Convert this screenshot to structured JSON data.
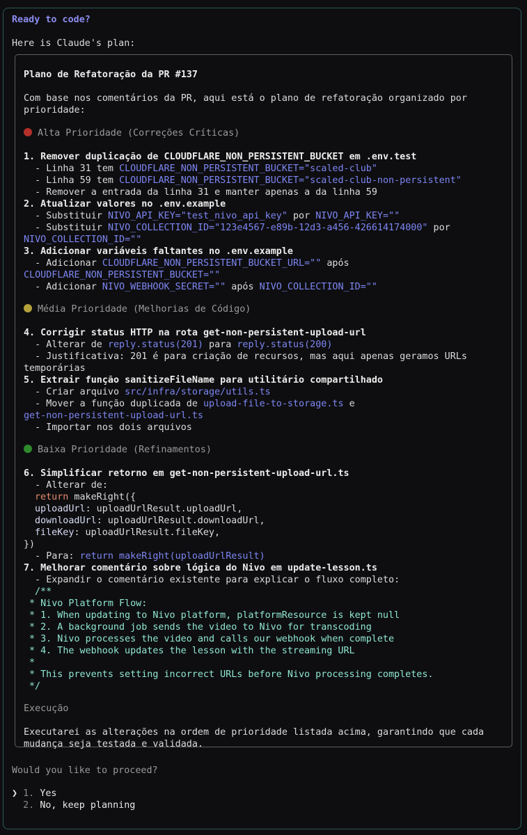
{
  "prompt": {
    "title": "Ready to code?",
    "intro": "Here is Claude's plan:"
  },
  "plan": {
    "title": "Plano de Refatoração da PR #137",
    "intro_1": "Com base nos comentários da PR, aqui está o plano de refatoração organizado por",
    "intro_2": "prioridade:",
    "high": {
      "heading": "Alta Prioridade (Correções Críticas)",
      "i1_title": "1. Remover duplicação de CLOUDFLARE_NON_PERSISTENT_BUCKET em .env.test",
      "i1_a_pre": "  - Linha 31 tem ",
      "i1_a_code": "CLOUDFLARE_NON_PERSISTENT_BUCKET=\"scaled-club\"",
      "i1_b_pre": "  - Linha 59 tem ",
      "i1_b_code": "CLOUDFLARE_NON_PERSISTENT_BUCKET=\"scaled-club-non-persistent\"",
      "i1_c": "  - Remover a entrada da linha 31 e manter apenas a da linha 59",
      "i2_title": "2. Atualizar valores no .env.example",
      "i2_a_pre": "  - Substituir ",
      "i2_a_code1": "NIVO_API_KEY=\"test_nivo_api_key\"",
      "i2_a_mid": " por ",
      "i2_a_code2": "NIVO_API_KEY=\"\"",
      "i2_b_pre": "  - Substituir ",
      "i2_b_code1": "NIVO_COLLECTION_ID=\"123e4567-e89b-12d3-a456-426614174000\"",
      "i2_b_mid": " por",
      "i2_b_code2": "NIVO_COLLECTION_ID=\"\"",
      "i3_title": "3. Adicionar variáveis faltantes no .env.example",
      "i3_a_pre": "  - Adicionar ",
      "i3_a_code1": "CLOUDFLARE_NON_PERSISTENT_BUCKET_URL=\"\"",
      "i3_a_mid": " após",
      "i3_a_code2": "CLOUDFLARE_NON_PERSISTENT_BUCKET=\"\"",
      "i3_b_pre": "  - Adicionar ",
      "i3_b_code1": "NIVO_WEBHOOK_SECRET=\"\"",
      "i3_b_mid": " após ",
      "i3_b_code2": "NIVO_COLLECTION_ID=\"\""
    },
    "medium": {
      "heading": "Média Prioridade (Melhorias de Código)",
      "i4_title": "4. Corrigir status HTTP na rota get-non-persistent-upload-url",
      "i4_a_pre": "  - Alterar de ",
      "i4_a_code1": "reply.status(201)",
      "i4_a_mid": " para ",
      "i4_a_code2": "reply.status(200)",
      "i4_b1": "  - Justificativa: 201 é para criação de recursos, mas aqui apenas geramos URLs",
      "i4_b2": "temporárias",
      "i5_title": "5. Extrair função sanitizeFileName para utilitário compartilhado",
      "i5_a_pre": "  - Criar arquivo ",
      "i5_a_code": "src/infra/storage/utils.ts",
      "i5_b_pre": "  - Mover a função duplicada de ",
      "i5_b_code1": "upload-file-to-storage.ts",
      "i5_b_mid": " e",
      "i5_b_code2": "get-non-persistent-upload-url.ts",
      "i5_c": "  - Importar nos dois arquivos"
    },
    "low": {
      "heading": "Baixa Prioridade (Refinamentos)",
      "i6_title": "6. Simplificar retorno em get-non-persistent-upload-url.ts",
      "i6_a": "  - Alterar de:",
      "c1_kw": "return",
      "c1_rest": " makeRight({",
      "c2_prop": "uploadUrl",
      "c2_rest": ": uploadUrlResult.uploadUrl,",
      "c3_prop": "downloadUrl",
      "c3_rest": ": uploadUrlResult.downloadUrl,",
      "c4_prop": "fileKey",
      "c4_rest": ": uploadUrlResult.fileKey,",
      "c5": "})",
      "i6_b_pre": "  - Para: ",
      "i6_b_code": "return makeRight(uploadUrlResult)",
      "i7_title": "7. Melhorar comentário sobre lógica do Nivo em update-lesson.ts",
      "i7_a": "  - Expandir o comentário existente para explicar o fluxo completo:",
      "d1": "/**",
      "d2": "* Nivo Platform Flow:",
      "d3": "* 1. When updating to Nivo platform, platformResource is kept null",
      "d4": "* 2. A background job sends the video to Nivo for transcoding",
      "d5": "* 3. Nivo processes the video and calls our webhook when complete",
      "d6": "* 4. The webhook updates the lesson with the streaming URL",
      "d7": "*",
      "d8": "* This prevents setting incorrect URLs before Nivo processing completes.",
      "d9": "*/"
    },
    "exec": {
      "heading": "Execução",
      "t1": "Executarei as alterações na ordem de prioridade listada acima, garantindo que cada",
      "t2": "mudança seja testada e validada."
    }
  },
  "question": "Would you like to proceed?",
  "options": [
    {
      "caret": "❯",
      "num": "1.",
      "label": "Yes"
    },
    {
      "caret": "",
      "num": "2.",
      "label": "No, keep planning"
    }
  ]
}
